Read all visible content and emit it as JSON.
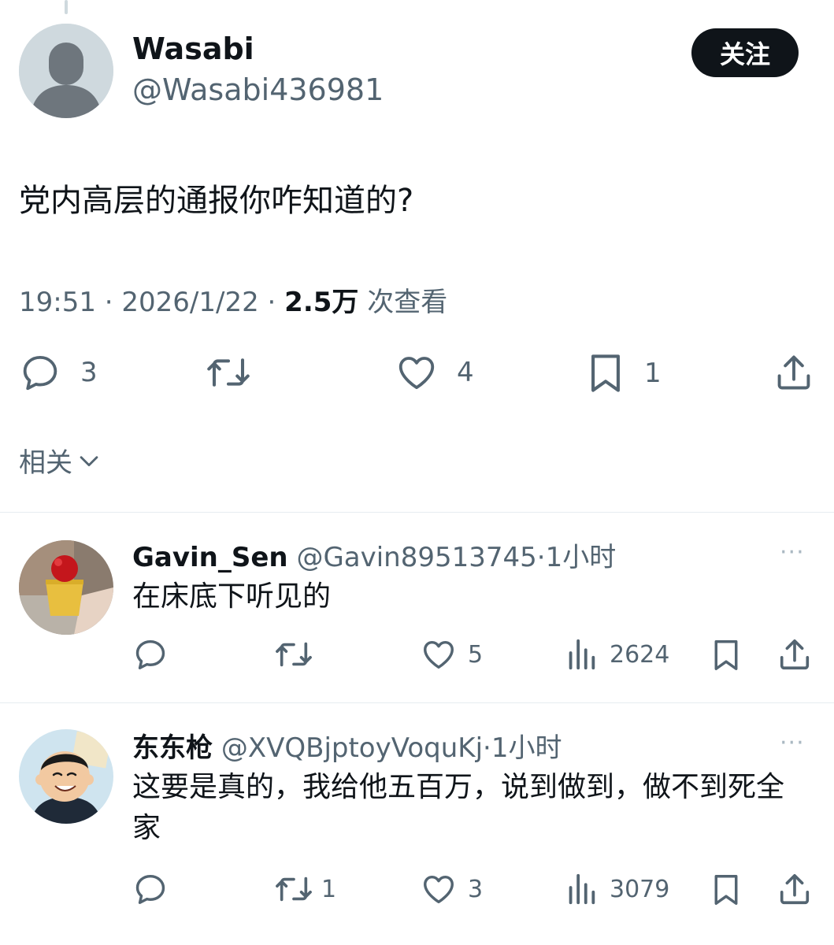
{
  "tweet": {
    "author_name": "Wasabi",
    "author_handle": "@Wasabi436981",
    "follow_label": "关注",
    "text": "党内高层的通报你咋知道的?",
    "time": "19:51 · 2026/1/22 · ",
    "views_count": "2.5万",
    "views_label": " 次查看",
    "replies": "3",
    "retweets": "",
    "likes": "4",
    "bookmarks": "1"
  },
  "related_label": "相关",
  "replies": [
    {
      "name": "Gavin_Sen",
      "handle": "@Gavin89513745",
      "time": "·1小时",
      "text": "在床底下听见的",
      "comments": "",
      "retweets": "",
      "likes": "5",
      "views": "2624",
      "more": "···"
    },
    {
      "name": "东东枪",
      "handle": "@XVQBjptoyVoquKj",
      "time": "·1小时",
      "text": "这要是真的，我给他五百万，说到做到，做不到死全家",
      "comments": "",
      "retweets": "1",
      "likes": "3",
      "views": "3079",
      "more": "···"
    }
  ],
  "icons": [
    "reply-icon",
    "retweet-icon",
    "like-icon",
    "bookmark-icon",
    "share-icon",
    "views-icon",
    "more-icon",
    "chevron-down-icon"
  ]
}
